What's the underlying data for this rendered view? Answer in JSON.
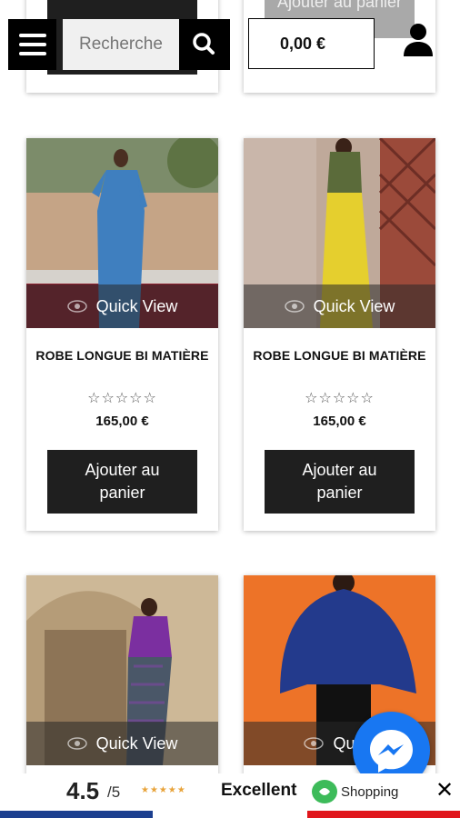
{
  "header": {
    "search_placeholder": "Recherche",
    "cart_total": "0,00 €"
  },
  "top_row": {
    "right_button_label": "Ajouter au panier"
  },
  "products": [
    {
      "title": "ROBE LONGUE BI MATIÈRE",
      "stars": "☆☆☆☆☆",
      "price": "165,00 €",
      "quick_view": "Quick View",
      "add_label": "Ajouter au panier"
    },
    {
      "title": "ROBE LONGUE BI MATIÈRE",
      "stars": "☆☆☆☆☆",
      "price": "165,00 €",
      "quick_view": "Quick View",
      "add_label": "Ajouter au panier"
    },
    {
      "quick_view": "Quick View"
    },
    {
      "quick_view": "Quick"
    }
  ],
  "rating_bar": {
    "score": "4.5",
    "scale": "/5",
    "stars": "★★★★★",
    "label": "Excellent",
    "brand": "Shopping",
    "close": "✕"
  }
}
